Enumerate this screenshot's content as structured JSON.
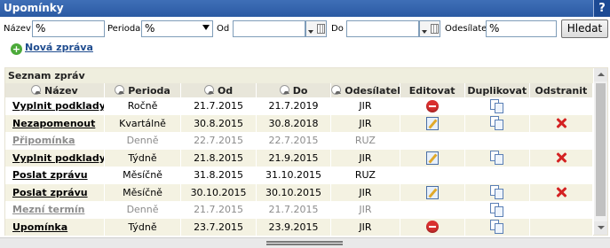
{
  "window": {
    "title": "Upomínky",
    "help_label": "?"
  },
  "filter": {
    "name_label": "Název",
    "name_value": "%",
    "period_label": "Perioda",
    "period_value": "%",
    "from_label": "Od",
    "from_value": "",
    "to_label": "Do",
    "to_value": "",
    "sender_label": "Odesílatel",
    "sender_value": "%",
    "search_label": "Hledat"
  },
  "new_message_label": "Nová zpráva",
  "list": {
    "caption": "Seznam zpráv",
    "columns": [
      "Název",
      "Perioda",
      "Od",
      "Do",
      "Odesílatel",
      "Editovat",
      "Duplikovat",
      "Odstranit"
    ],
    "rows": [
      {
        "name": "Vyplnit podklady",
        "period": "Ročně",
        "from": "21.7.2015",
        "to": "21.7.2019",
        "sender": "JIR",
        "edit": "remove",
        "duplicate": true,
        "delete": false,
        "inactive": false
      },
      {
        "name": "Nezapomenout",
        "period": "Kvartálně",
        "from": "30.8.2015",
        "to": "30.8.2018",
        "sender": "JIR",
        "edit": "edit",
        "duplicate": true,
        "delete": true,
        "inactive": false
      },
      {
        "name": "Připomínka",
        "period": "Denně",
        "from": "22.7.2015",
        "to": "22.7.2015",
        "sender": "RUZ",
        "edit": "",
        "duplicate": false,
        "delete": false,
        "inactive": true
      },
      {
        "name": "Vyplnit podklady",
        "period": "Týdně",
        "from": "21.8.2015",
        "to": "21.9.2015",
        "sender": "JIR",
        "edit": "edit",
        "duplicate": true,
        "delete": true,
        "inactive": false
      },
      {
        "name": "Poslat zprávu",
        "period": "Měsíčně",
        "from": "31.8.2015",
        "to": "31.10.2015",
        "sender": "RUZ",
        "edit": "",
        "duplicate": false,
        "delete": false,
        "inactive": false
      },
      {
        "name": "Poslat zprávu",
        "period": "Měsíčně",
        "from": "30.10.2015",
        "to": "30.10.2015",
        "sender": "JIR",
        "edit": "edit",
        "duplicate": true,
        "delete": true,
        "inactive": false
      },
      {
        "name": "Mezní termín",
        "period": "Denně",
        "from": "21.7.2015",
        "to": "21.7.2015",
        "sender": "JIR",
        "edit": "",
        "duplicate": true,
        "delete": false,
        "inactive": true
      },
      {
        "name": "Upomínka",
        "period": "Týdně",
        "from": "23.7.2015",
        "to": "23.9.2015",
        "sender": "JIR",
        "edit": "remove",
        "duplicate": true,
        "delete": false,
        "inactive": false
      }
    ]
  },
  "colors": {
    "titlebar": "#2f5fa9",
    "row_alt": "#f4f2e2",
    "header": "#e8e6da",
    "delete": "#d42222",
    "add": "#4caa3a"
  },
  "icons": {
    "add": "plus-circle-icon",
    "sort": "sort-icon",
    "edit": "pencil-icon",
    "remove": "minus-circle-icon",
    "duplicate": "copy-icon",
    "delete": "x-icon",
    "calendar": "calendar-icon"
  }
}
